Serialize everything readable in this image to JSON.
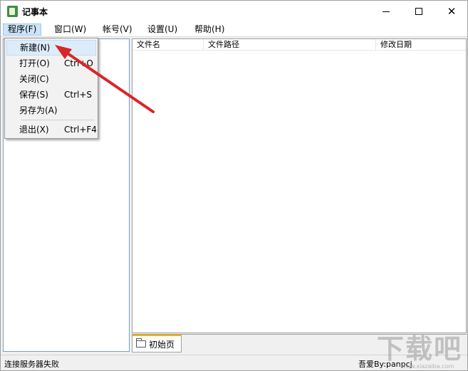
{
  "window": {
    "title": "记事本",
    "icons": {
      "app": "notepad-app-icon",
      "minimize": "minimize-icon",
      "maximize": "maximize-icon",
      "close": "close-icon"
    },
    "close_glyph": "✕"
  },
  "menubar": {
    "items": [
      {
        "label": "程序(F)",
        "active": true
      },
      {
        "label": "窗口(W)"
      },
      {
        "label": "帐号(V)"
      },
      {
        "label": "设置(U)"
      },
      {
        "label": "帮助(H)"
      }
    ]
  },
  "file_menu": {
    "items": [
      {
        "label": "新建(N)",
        "shortcut": "",
        "highlighted": true
      },
      {
        "label": "打开(O)",
        "shortcut": "Ctrl+O"
      },
      {
        "label": "关闭(C)",
        "shortcut": ""
      },
      {
        "label": "保存(S)",
        "shortcut": "Ctrl+S"
      },
      {
        "label": "另存为(A)",
        "shortcut": ""
      },
      {
        "label": "退出(X)",
        "shortcut": "Ctrl+F4"
      }
    ]
  },
  "file_list": {
    "columns": [
      "文件名",
      "文件路径",
      "修改日期"
    ]
  },
  "tabs": [
    {
      "label": "初始页",
      "icon": "folder-icon"
    }
  ],
  "statusbar": {
    "left": "连接服务器失败",
    "right": "吾爱By:panpcj"
  },
  "watermark": {
    "text": "下载吧",
    "sub": "www.xiazaiba.com"
  },
  "colors": {
    "menu_active": "#cce4f7",
    "tab_accent": "#f1b400",
    "arrow": "#d9262a"
  }
}
